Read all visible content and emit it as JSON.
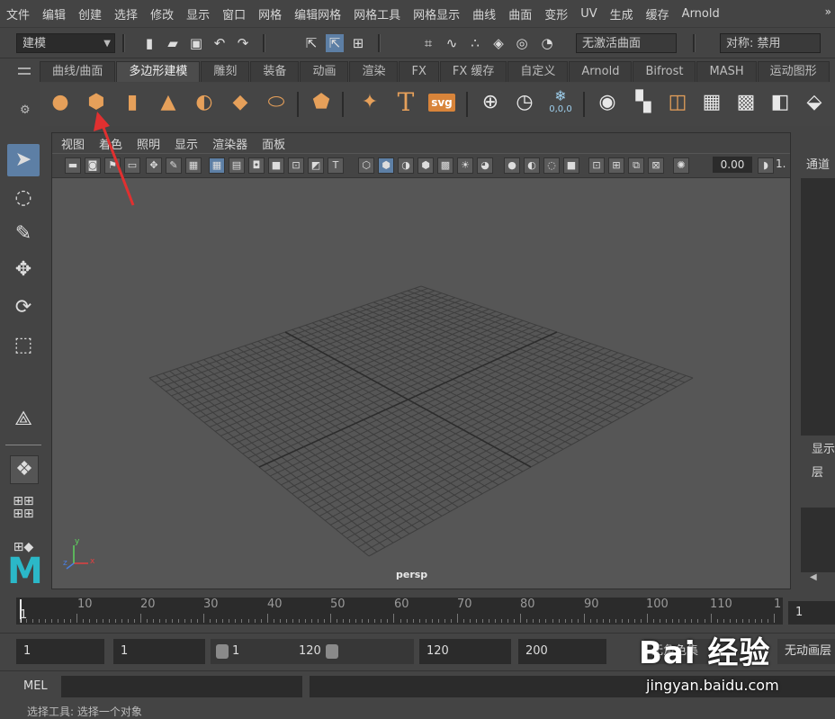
{
  "menubar": {
    "items": [
      "文件",
      "编辑",
      "创建",
      "选择",
      "修改",
      "显示",
      "窗口",
      "网格",
      "编辑网格",
      "网格工具",
      "网格显示",
      "曲线",
      "曲面",
      "变形",
      "UV",
      "生成",
      "缓存",
      "Arnold"
    ],
    "more": "»"
  },
  "statusline": {
    "mode": "建模",
    "live_surface": "无激活曲面",
    "symmetry": "对称: 禁用"
  },
  "shelf": {
    "tabs": [
      "曲线/曲面",
      "多边形建模",
      "雕刻",
      "装备",
      "动画",
      "渲染",
      "FX",
      "FX 缓存",
      "自定义",
      "Arnold",
      "Bifrost",
      "MASH",
      "运动图形"
    ],
    "active_tab": 1,
    "icons": [
      "poly-sphere-icon",
      "poly-cube-icon",
      "poly-cylinder-icon",
      "poly-cone-icon",
      "poly-torus-icon",
      "poly-plane-icon",
      "poly-disk-icon",
      "platonic-solid-icon",
      "super-shape-icon",
      "poly-text-icon",
      "svg-icon",
      "sweep-mesh-icon",
      "bevel-icon",
      "poly-count-icon",
      "combine-icon",
      "separate-icon",
      "mirror-icon",
      "smooth-icon",
      "extract-icon",
      "boolean-icon"
    ],
    "svg_label": "svg",
    "text_label": "T",
    "count_label": "0,0,0"
  },
  "viewport": {
    "menu": [
      "视图",
      "着色",
      "照明",
      "显示",
      "渲染器",
      "面板"
    ],
    "near_clip": "0.00",
    "far_value": "1.",
    "camera": "persp",
    "axis": {
      "x": "x",
      "y": "y",
      "z": "z"
    }
  },
  "channel": {
    "title": "通道",
    "layer_title": "显示",
    "layer_label": "层"
  },
  "timeslider": {
    "labels": [
      "1",
      "10",
      "20",
      "30",
      "40",
      "50",
      "60",
      "70",
      "80",
      "90",
      "100",
      "110",
      "1"
    ],
    "current_frame": "1"
  },
  "range": {
    "start": "1",
    "playback_start": "1",
    "slider_start": "1",
    "slider_end": "120",
    "playback_end": "120",
    "end": "200",
    "char_set": "无角色集",
    "anim_layer": "无动画层"
  },
  "cmd": {
    "mel": "MEL"
  },
  "help": {
    "text": "选择工具: 选择一个对象"
  },
  "watermark": {
    "logo": "Bai 经验",
    "url": "jingyan.baidu.com"
  },
  "colors": {
    "ui_bg": "#444444",
    "viewport_bg": "#565656",
    "shelf_icon": "#e6a05a",
    "selection": "#5d7fa5",
    "annotation_arrow": "#e03030"
  }
}
